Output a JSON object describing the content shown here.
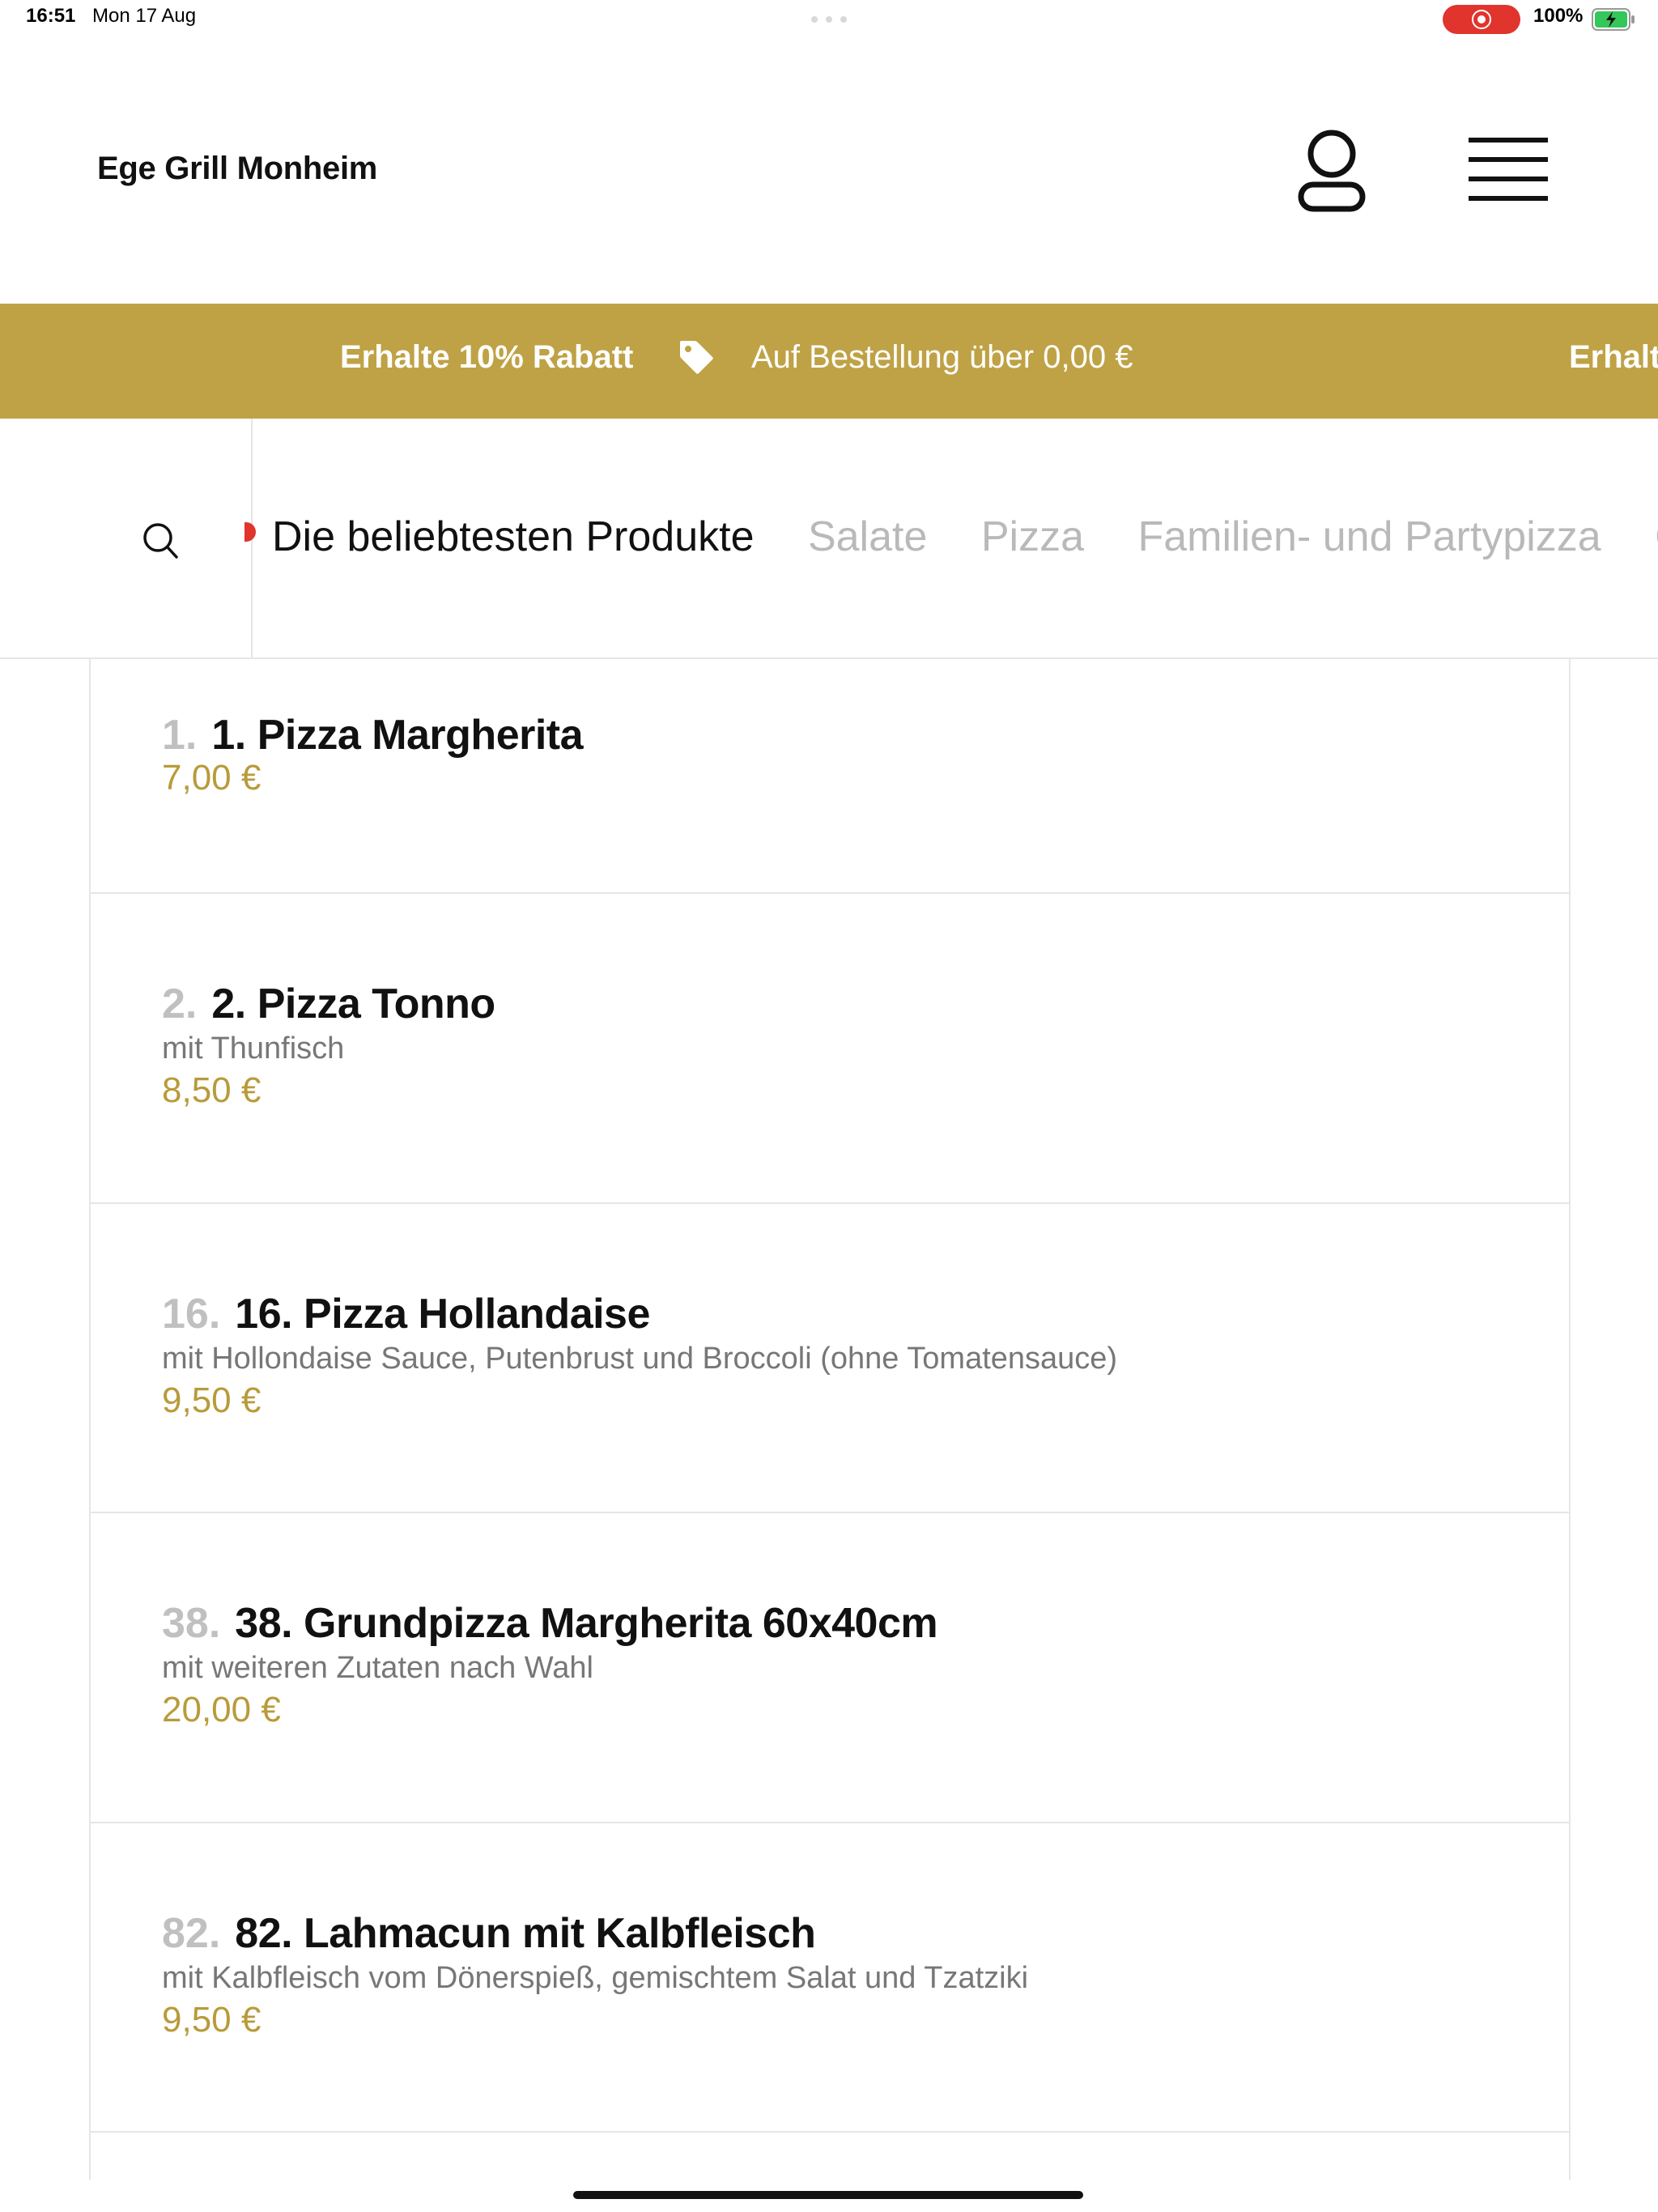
{
  "status_bar": {
    "time": "16:51",
    "date": "Mon 17 Aug",
    "battery_percent": "100%",
    "battery_level": 1.0,
    "recording_active": true
  },
  "header": {
    "brand": "Ege Grill Monheim",
    "user_icon": "user-icon",
    "menu_icon": "hamburger-menu-icon"
  },
  "promo": {
    "title": "Erhalte 10% Rabatt",
    "icon": "tag-icon",
    "subtitle": "Auf Bestellung über 0,00 €",
    "title_repeat": "Erhalt",
    "color": "#bfa245"
  },
  "categories": {
    "search_icon": "search-icon",
    "tabs": [
      {
        "label": "Die beliebtesten Produkte",
        "active": true
      },
      {
        "label": "Salate",
        "active": false
      },
      {
        "label": "Pizza",
        "active": false
      },
      {
        "label": "Familien- und Partypizza",
        "active": false
      },
      {
        "label": "Ca",
        "active": false
      }
    ]
  },
  "products": [
    {
      "num": "1.",
      "name": "1. Pizza Margherita",
      "desc": "",
      "price": "7,00 €"
    },
    {
      "num": "2.",
      "name": "2. Pizza Tonno",
      "desc": "mit Thunfisch",
      "price": "8,50 €"
    },
    {
      "num": "16.",
      "name": "16. Pizza Hollandaise",
      "desc": "mit Hollondaise Sauce, Putenbrust und Broccoli (ohne Tomatensauce)",
      "price": "9,50 €"
    },
    {
      "num": "38.",
      "name": "38. Grundpizza Margherita 60x40cm",
      "desc": "mit weiteren Zutaten nach Wahl",
      "price": "20,00 €"
    },
    {
      "num": "82.",
      "name": "82. Lahmacun mit Kalbfleisch",
      "desc": "mit Kalbfleisch vom Dönerspieß, gemischtem Salat und Tzatziki",
      "price": "9,50 €"
    }
  ],
  "colors": {
    "accent_gold": "#bfa245",
    "price_gold": "#b89b3a",
    "record_red": "#e0342c"
  }
}
